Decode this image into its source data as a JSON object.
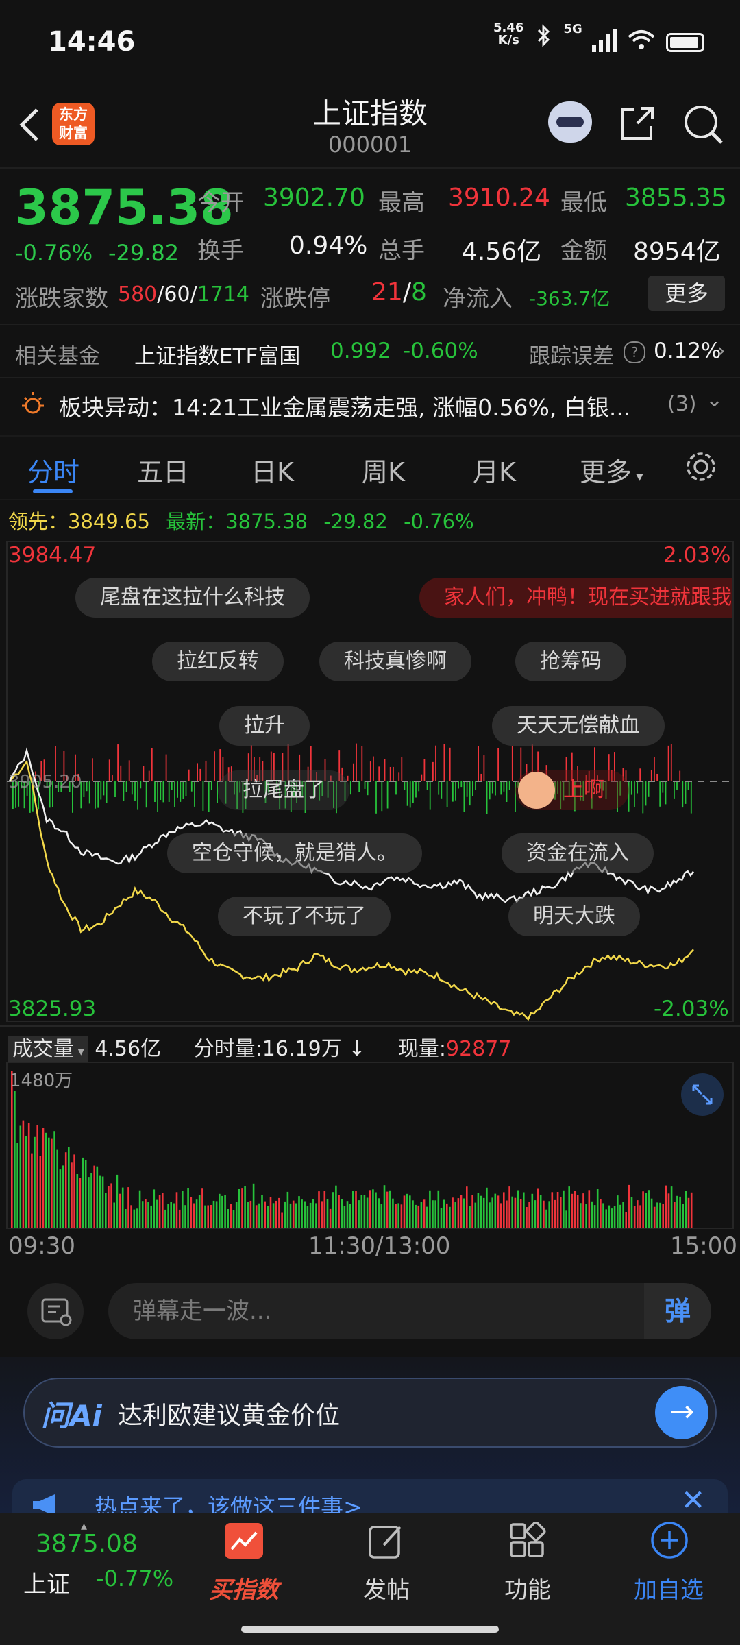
{
  "status": {
    "time": "14:46",
    "speed": "5.46",
    "speed_unit": "K/s",
    "network": "5G"
  },
  "header": {
    "title": "上证指数",
    "code": "000001",
    "logo_text": "东方财富"
  },
  "quote": {
    "price": "3875.38",
    "change_pct": "-0.76%",
    "change_abs": "-29.82",
    "open_label": "今开",
    "open": "3902.70",
    "high_label": "最高",
    "high": "3910.24",
    "low_label": "最低",
    "low": "3855.35",
    "turnover_label": "换手",
    "turnover": "0.94%",
    "volume_label": "总手",
    "volume": "4.56亿",
    "amount_label": "金额",
    "amount": "8954亿",
    "breadth_label": "涨跌家数",
    "up_count": "580",
    "flat_count": "60",
    "down_count": "1714",
    "limit_label": "涨跌停",
    "limit_up": "21",
    "limit_down": "8",
    "inflow_label": "净流入",
    "inflow": "-363.7亿",
    "more_label": "更多"
  },
  "fund": {
    "label": "相关基金",
    "name": "上证指数ETF富国",
    "price": "0.992",
    "change": "-0.60%",
    "tracking_label": "跟踪误差",
    "tracking": "0.12%"
  },
  "alert": {
    "text": "板块异动：14:21工业金属震荡走强, 涨幅0.56%, 白银...",
    "count": "(3)"
  },
  "tabs": [
    "分时",
    "五日",
    "日K",
    "周K",
    "月K",
    "更多"
  ],
  "legend": {
    "lead_label": "领先：",
    "lead": "3849.65",
    "last_label": "最新：",
    "last": "3875.38",
    "change": "-29.82",
    "pct": "-0.76%"
  },
  "axis": {
    "y_top": "3984.47",
    "y_bottom": "3825.93",
    "pct_top": "2.03%",
    "pct_bottom": "-2.03%",
    "ref": "3905.20"
  },
  "danmu": [
    "尾盘在这拉什么科技",
    "家人们，冲鸭！现在买进就跟我",
    "拉红反转",
    "科技真惨啊",
    "抢筹码",
    "拉升",
    "天天无偿献血",
    "拉尾盘了",
    "上啊",
    "空仓守候，就是猎人。",
    "资金在流入",
    "不玩了不玩了",
    "明天大跌"
  ],
  "volume_row": {
    "label": "成交量",
    "total": "4.56亿",
    "minute_label": "分时量:",
    "minute": "16.19万",
    "now_label": "现量:",
    "now": "92877",
    "max": "1480万"
  },
  "time_axis": [
    "09:30",
    "11:30/13:00",
    "15:00"
  ],
  "danmu_input": {
    "placeholder": "弹幕走一波...",
    "send": "弹"
  },
  "ai": {
    "logo": "问Ai",
    "text": "达利欧建议黄金价位"
  },
  "notice": {
    "text": "热点来了，该做这三件事>"
  },
  "nav": {
    "index_price": "3875.08",
    "index_name": "上证",
    "index_pct": "-0.77%",
    "buy": "买指数",
    "post": "发帖",
    "func": "功能",
    "add": "加自选"
  },
  "colors": {
    "up": "#f0343b",
    "down": "#27c23b",
    "accent": "#3b86f5",
    "avg_line": "#f2d84a"
  },
  "chart_data": {
    "type": "line",
    "title": "",
    "xlabel": "",
    "ylabel": "",
    "x_ticks": [
      "09:30",
      "11:30/13:00",
      "15:00"
    ],
    "ylim": [
      3825.93,
      3984.47
    ],
    "reference": 3905.2,
    "series": [
      {
        "name": "最新",
        "values": [
          3905.2,
          3915.0,
          3893.0,
          3888.5,
          3882.0,
          3880.0,
          3878.5,
          3880.5,
          3885.0,
          3889.0,
          3890.5,
          3891.5,
          3889.0,
          3887.5,
          3885.5,
          3880.0,
          3878.0,
          3876.0,
          3872.5,
          3872.0,
          3870.0,
          3873.5,
          3873.0,
          3871.0,
          3871.0,
          3872.0,
          3867.5,
          3867.0,
          3866.0,
          3868.5,
          3870.0,
          3874.0,
          3878.0,
          3876.0,
          3873.0,
          3870.0,
          3869.0,
          3872.0,
          3875.4
        ]
      },
      {
        "name": "领先",
        "values": [
          3905.2,
          3912.0,
          3880.0,
          3865.0,
          3856.0,
          3858.0,
          3864.0,
          3869.0,
          3866.0,
          3860.0,
          3855.0,
          3847.0,
          3843.0,
          3841.0,
          3840.0,
          3841.5,
          3843.5,
          3848.0,
          3845.0,
          3843.0,
          3844.0,
          3845.0,
          3842.5,
          3842.0,
          3840.5,
          3836.5,
          3834.0,
          3831.0,
          3828.0,
          3827.5,
          3833.5,
          3839.0,
          3844.0,
          3847.5,
          3846.5,
          3845.0,
          3844.5,
          3844.5,
          3849.65
        ]
      }
    ],
    "volume_max": "1480万"
  }
}
